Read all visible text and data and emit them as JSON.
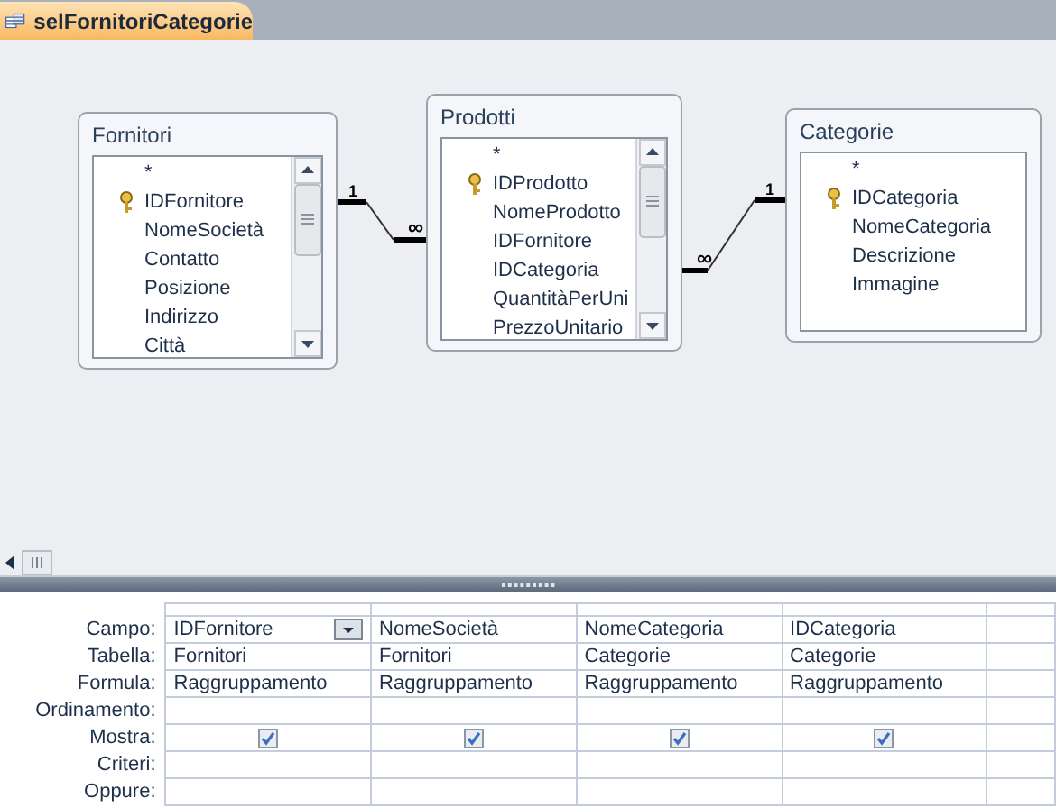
{
  "tab": {
    "title": "selFornitoriCategorie",
    "selected": true
  },
  "tables": [
    {
      "name": "Fornitori",
      "scrollable": true,
      "fields": [
        {
          "name": "*",
          "key": false
        },
        {
          "name": "IDFornitore",
          "key": true
        },
        {
          "name": "NomeSocietà",
          "key": false
        },
        {
          "name": "Contatto",
          "key": false
        },
        {
          "name": "Posizione",
          "key": false
        },
        {
          "name": "Indirizzo",
          "key": false
        },
        {
          "name": "Città",
          "key": false
        }
      ]
    },
    {
      "name": "Prodotti",
      "scrollable": true,
      "fields": [
        {
          "name": "*",
          "key": false
        },
        {
          "name": "IDProdotto",
          "key": true
        },
        {
          "name": "NomeProdotto",
          "key": false
        },
        {
          "name": "IDFornitore",
          "key": false
        },
        {
          "name": "IDCategoria",
          "key": false
        },
        {
          "name": "QuantitàPerUni",
          "key": false
        },
        {
          "name": "PrezzoUnitario",
          "key": false
        }
      ]
    },
    {
      "name": "Categorie",
      "scrollable": false,
      "fields": [
        {
          "name": "*",
          "key": false
        },
        {
          "name": "IDCategoria",
          "key": true
        },
        {
          "name": "NomeCategoria",
          "key": false
        },
        {
          "name": "Descrizione",
          "key": false
        },
        {
          "name": "Immagine",
          "key": false
        }
      ]
    }
  ],
  "relationships": [
    {
      "one": "1",
      "many": "∞"
    },
    {
      "one": "1",
      "many": "∞"
    }
  ],
  "grid": {
    "row_labels": [
      "Campo:",
      "Tabella:",
      "Formula:",
      "Ordinamento:",
      "Mostra:",
      "Criteri:",
      "Oppure:"
    ],
    "columns": [
      {
        "field": "IDFornitore",
        "table": "Fornitori",
        "total": "Raggruppamento",
        "show": true,
        "selected": true
      },
      {
        "field": "NomeSocietà",
        "table": "Fornitori",
        "total": "Raggruppamento",
        "show": true,
        "selected": false
      },
      {
        "field": "NomeCategoria",
        "table": "Categorie",
        "total": "Raggruppamento",
        "show": true,
        "selected": false
      },
      {
        "field": "IDCategoria",
        "table": "Categorie",
        "total": "Raggruppamento",
        "show": true,
        "selected": false
      }
    ]
  }
}
